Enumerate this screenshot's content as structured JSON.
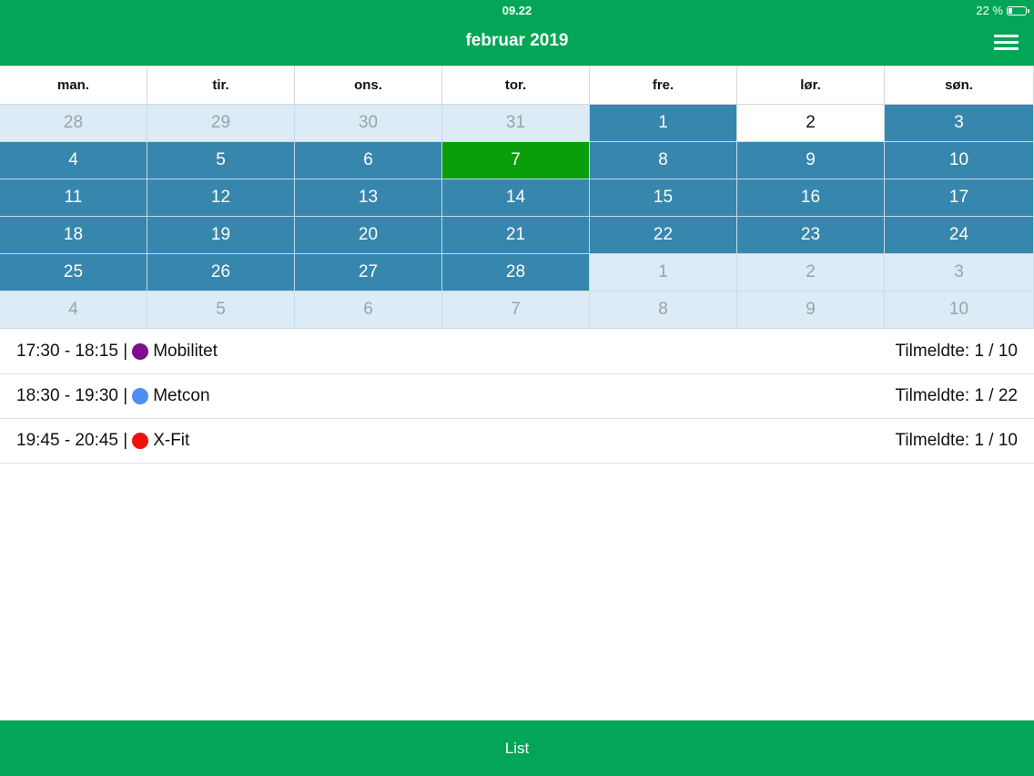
{
  "status": {
    "time": "09.22",
    "battery": "22 %"
  },
  "header": {
    "title": "februar 2019",
    "menu_icon": "hamburger-menu-icon"
  },
  "weekdays": [
    "man.",
    "tir.",
    "ons.",
    "tor.",
    "fre.",
    "lør.",
    "søn."
  ],
  "calendar": {
    "weeks": [
      [
        {
          "d": "28",
          "s": "other"
        },
        {
          "d": "29",
          "s": "other"
        },
        {
          "d": "30",
          "s": "other"
        },
        {
          "d": "31",
          "s": "other"
        },
        {
          "d": "1",
          "s": "avail"
        },
        {
          "d": "2",
          "s": "plain"
        },
        {
          "d": "3",
          "s": "avail"
        }
      ],
      [
        {
          "d": "4",
          "s": "avail"
        },
        {
          "d": "5",
          "s": "avail"
        },
        {
          "d": "6",
          "s": "avail"
        },
        {
          "d": "7",
          "s": "today"
        },
        {
          "d": "8",
          "s": "avail"
        },
        {
          "d": "9",
          "s": "avail"
        },
        {
          "d": "10",
          "s": "avail"
        }
      ],
      [
        {
          "d": "11",
          "s": "avail"
        },
        {
          "d": "12",
          "s": "avail"
        },
        {
          "d": "13",
          "s": "avail"
        },
        {
          "d": "14",
          "s": "avail"
        },
        {
          "d": "15",
          "s": "avail"
        },
        {
          "d": "16",
          "s": "avail"
        },
        {
          "d": "17",
          "s": "avail"
        }
      ],
      [
        {
          "d": "18",
          "s": "avail"
        },
        {
          "d": "19",
          "s": "avail"
        },
        {
          "d": "20",
          "s": "avail"
        },
        {
          "d": "21",
          "s": "avail"
        },
        {
          "d": "22",
          "s": "avail"
        },
        {
          "d": "23",
          "s": "avail"
        },
        {
          "d": "24",
          "s": "avail"
        }
      ],
      [
        {
          "d": "25",
          "s": "avail"
        },
        {
          "d": "26",
          "s": "avail"
        },
        {
          "d": "27",
          "s": "avail"
        },
        {
          "d": "28",
          "s": "avail"
        },
        {
          "d": "1",
          "s": "other"
        },
        {
          "d": "2",
          "s": "other"
        },
        {
          "d": "3",
          "s": "other"
        }
      ],
      [
        {
          "d": "4",
          "s": "other"
        },
        {
          "d": "5",
          "s": "other"
        },
        {
          "d": "6",
          "s": "other"
        },
        {
          "d": "7",
          "s": "other"
        },
        {
          "d": "8",
          "s": "other"
        },
        {
          "d": "9",
          "s": "other"
        },
        {
          "d": "10",
          "s": "other"
        }
      ]
    ]
  },
  "events": [
    {
      "time": "17:30 - 18:15 |",
      "name": "Mobilitet",
      "color": "#7d0e8c",
      "signup": "Tilmeldte: 1 / 10"
    },
    {
      "time": "18:30 - 19:30 |",
      "name": "Metcon",
      "color": "#4f8ff0",
      "signup": "Tilmeldte: 1 / 22"
    },
    {
      "time": "19:45 - 20:45 |",
      "name": "X-Fit",
      "color": "#f0110e",
      "signup": "Tilmeldte: 1 / 10"
    }
  ],
  "footer": {
    "label": "List"
  },
  "colors": {
    "brand": "#03a556",
    "available_day": "#3786ad",
    "today": "#0a9e0a",
    "other_month": "#dcebf5"
  }
}
